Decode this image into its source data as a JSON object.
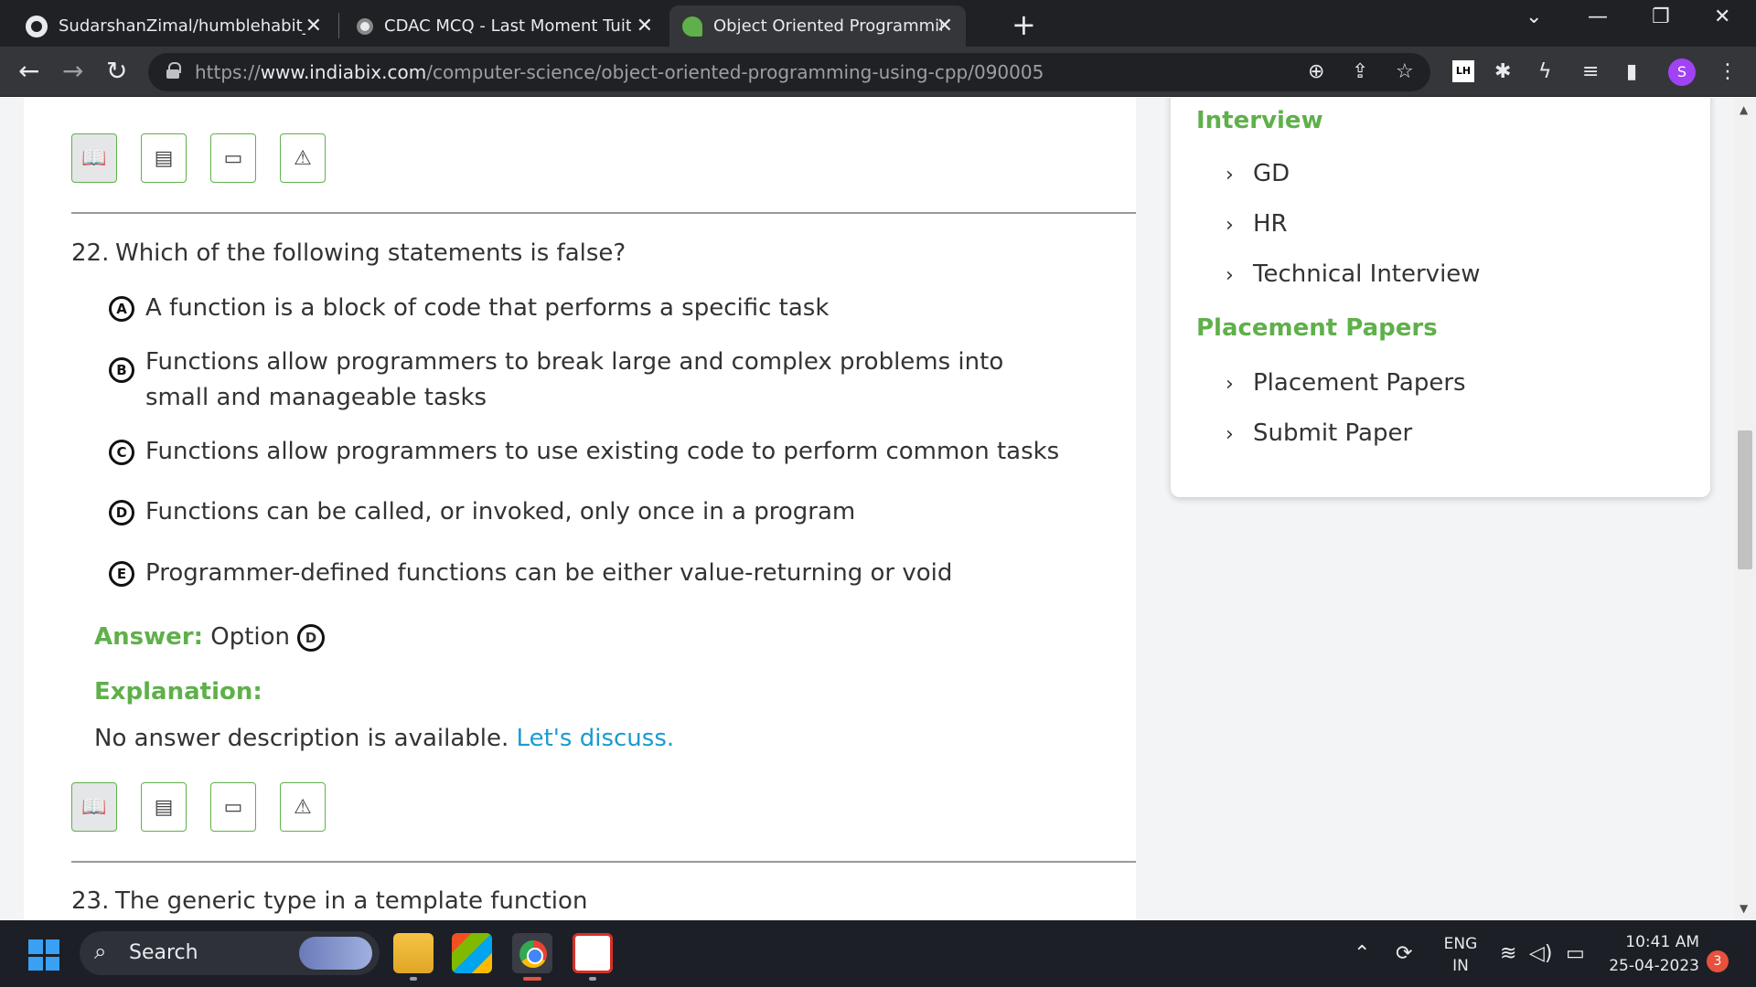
{
  "browser": {
    "tabs": [
      {
        "title": "SudarshanZimal/humblehabit_C-",
        "icon": "github-icon"
      },
      {
        "title": "CDAC MCQ - Last Moment Tuitio",
        "icon": "site-icon"
      },
      {
        "title": "Object Oriented Programming U",
        "icon": "indiabix-icon",
        "active": true
      }
    ],
    "url_scheme": "https://",
    "url_host": "www.indiabix.com",
    "url_path": "/computer-science/object-oriented-programming-using-cpp/090005",
    "profile_initial": "S",
    "extension_badge": "LH"
  },
  "question22": {
    "number": "22.",
    "text": "Which of the following statements is false?",
    "options": [
      {
        "letter": "A",
        "text": "A function is a block of code that performs a specific task"
      },
      {
        "letter": "B",
        "text": "Functions allow programmers to break large and complex problems into small and manageable tasks"
      },
      {
        "letter": "C",
        "text": "Functions allow programmers to use existing code to perform common tasks"
      },
      {
        "letter": "D",
        "text": "Functions can be called, or invoked, only once in a program"
      },
      {
        "letter": "E",
        "text": "Programmer-defined functions can be either value-returning or void"
      }
    ],
    "answer_label": "Answer:",
    "answer_prefix": "Option",
    "answer_letter": "D",
    "explanation_label": "Explanation:",
    "explanation_text": "No answer description is available.",
    "discuss_link": "Let's discuss."
  },
  "question23": {
    "number": "23.",
    "text": "The generic type in a template function"
  },
  "sidebar": {
    "interview_heading": "Interview",
    "interview_items": [
      "GD",
      "HR",
      "Technical Interview"
    ],
    "placement_heading": "Placement Papers",
    "placement_items": [
      "Placement Papers",
      "Submit Paper"
    ]
  },
  "taskbar": {
    "search_placeholder": "Search",
    "lang_top": "ENG",
    "lang_bottom": "IN",
    "time": "10:41 AM",
    "date": "25-04-2023",
    "notification_count": "3"
  },
  "colors": {
    "accent_green": "#5fb04a",
    "link_blue": "#1a9bcf",
    "chrome_dark": "#202124"
  }
}
